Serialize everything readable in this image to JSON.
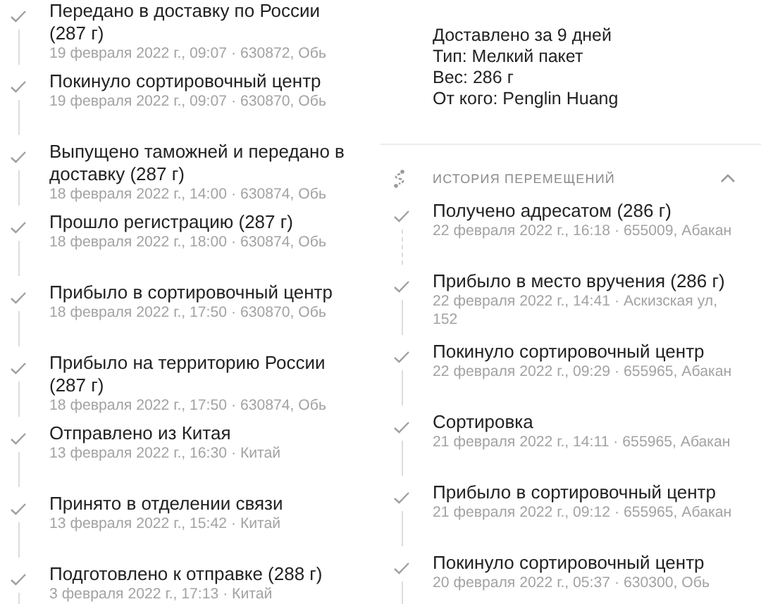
{
  "left_events": [
    {
      "title": "Передано в доставку по России (287 г)",
      "details": "19 февраля 2022 г., 09:07 · 630872, Обь",
      "dashed_connector": false
    },
    {
      "title": "Покинуло сортировочный центр",
      "details": "19 февраля 2022 г., 09:07 · 630870, Обь",
      "dashed_connector": false
    },
    {
      "title": "Выпущено таможней и передано в доставку (287 г)",
      "details": "18 февраля 2022 г., 14:00 · 630874, Обь",
      "dashed_connector": false
    },
    {
      "title": "Прошло регистрацию (287 г)",
      "details": "18 февраля 2022 г., 18:00 · 630874, Обь",
      "dashed_connector": false
    },
    {
      "title": "Прибыло в сортировочный центр",
      "details": "18 февраля 2022 г., 17:50 · 630870, Обь",
      "dashed_connector": false
    },
    {
      "title": "Прибыло на территорию России (287 г)",
      "details": "18 февраля 2022 г., 17:50 · 630874, Обь",
      "dashed_connector": false
    },
    {
      "title": "Отправлено из Китая",
      "details": "13 февраля 2022 г., 16:30 · Китай",
      "dashed_connector": false
    },
    {
      "title": "Принято в отделении связи",
      "details": "13 февраля 2022 г., 15:42 · Китай",
      "dashed_connector": false
    },
    {
      "title": "Подготовлено к отправке (288 г)",
      "details": "3 февраля 2022 г., 17:13 · Китай",
      "dashed_connector": false
    }
  ],
  "shipment_info": {
    "lines": [
      "Доставлено за 9 дней",
      "Тип: Мелкий пакет",
      "Вес: 286 г",
      "От кого: Penglin Huang"
    ]
  },
  "history": {
    "title": "ИСТОРИЯ ПЕРЕМЕЩЕНИЙ",
    "expanded": true,
    "events": [
      {
        "title": "Получено адресатом (286 г)",
        "details": "22 февраля 2022 г., 16:18 · 655009, Абакан",
        "dashed_connector": true
      },
      {
        "title": "Прибыло в место вручения (286 г)",
        "details": "22 февраля 2022 г., 14:41 · Аскизская ул, 152",
        "dashed_connector": false
      },
      {
        "title": "Покинуло сортировочный центр",
        "details": "22 февраля 2022 г., 09:29 · 655965, Абакан",
        "dashed_connector": false
      },
      {
        "title": "Сортировка",
        "details": "21 февраля 2022 г., 14:11 · 655965, Абакан",
        "dashed_connector": false
      },
      {
        "title": "Прибыло в сортировочный центр",
        "details": "21 февраля 2022 г., 09:12 · 655965, Абакан",
        "dashed_connector": false
      },
      {
        "title": "Покинуло сортировочный центр",
        "details": "20 февраля 2022 г., 05:37 · 630300, Обь",
        "dashed_connector": false
      }
    ]
  }
}
